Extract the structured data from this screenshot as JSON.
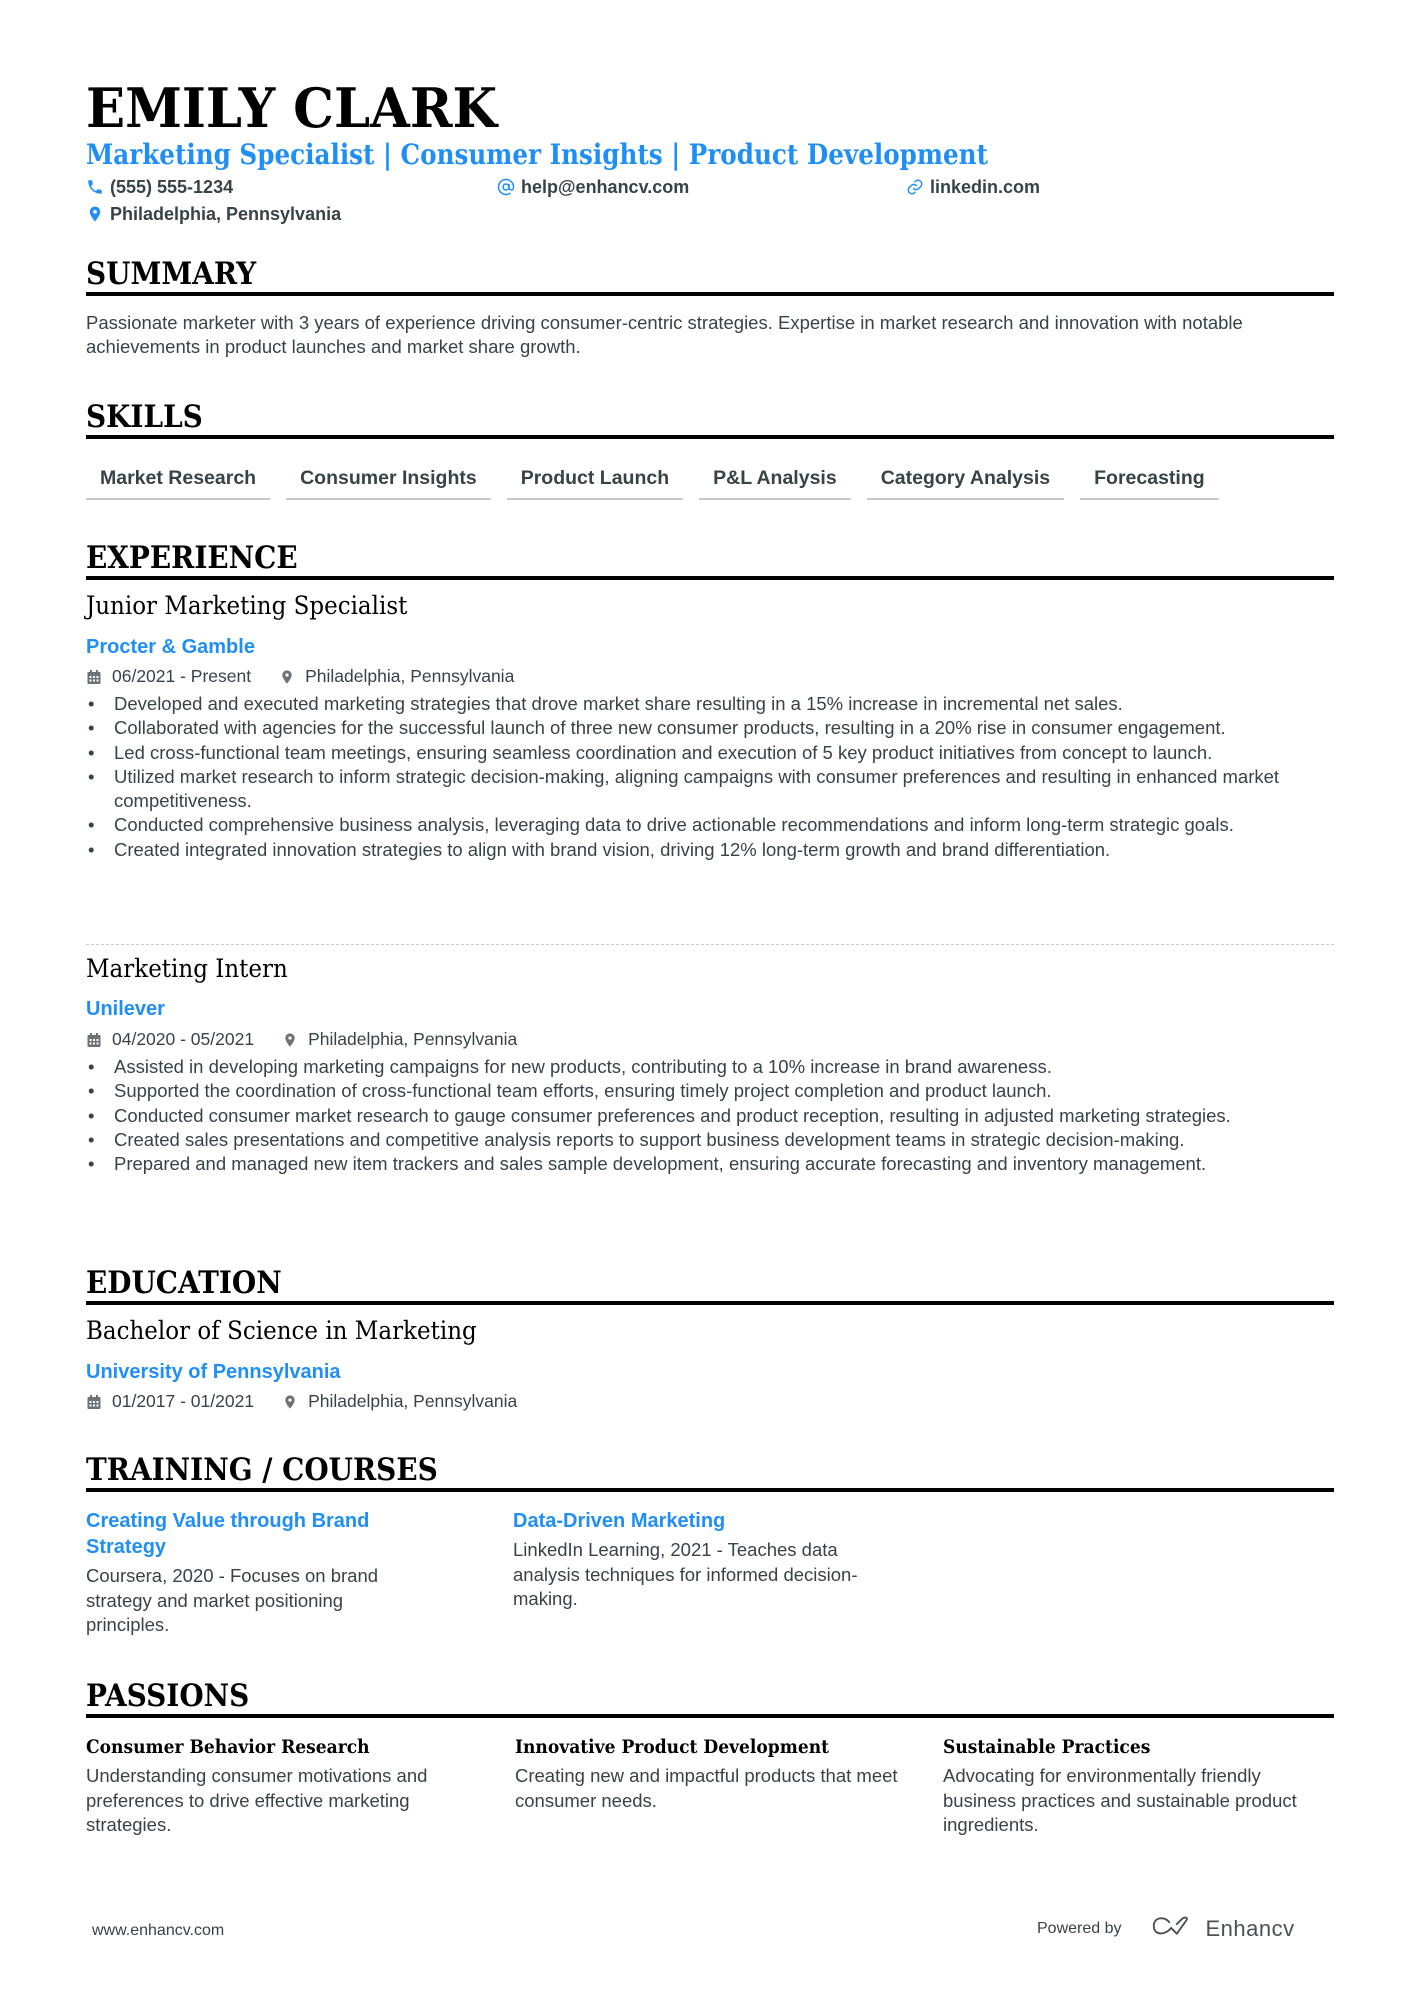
{
  "header": {
    "name": "EMILY CLARK",
    "subtitle": "Marketing Specialist | Consumer Insights | Product Development",
    "contacts": {
      "phone": {
        "icon": "phone-icon",
        "value": "(555) 555-1234"
      },
      "email": {
        "icon": "at-icon",
        "value": "help@enhancv.com"
      },
      "linkedin": {
        "icon": "link-icon",
        "value": "linkedin.com"
      },
      "location": {
        "icon": "location-pin-icon",
        "value": "Philadelphia, Pennsylvania"
      }
    }
  },
  "summary": {
    "heading": "SUMMARY",
    "text": "Passionate marketer with 3 years of experience driving consumer-centric strategies. Expertise in market research and innovation with notable achievements in product launches and market share growth."
  },
  "skills": {
    "heading": "SKILLS",
    "items": [
      "Market Research",
      "Consumer Insights",
      "Product Launch",
      "P&L Analysis",
      "Category Analysis",
      "Forecasting"
    ]
  },
  "experience": {
    "heading": "EXPERIENCE",
    "jobs": [
      {
        "title": "Junior Marketing Specialist",
        "company": "Procter & Gamble",
        "dates": "06/2021 - Present",
        "location": "Philadelphia, Pennsylvania",
        "bullets": [
          "Developed and executed marketing strategies that drove market share resulting in a 15% increase in incremental net sales.",
          "Collaborated with agencies for the successful launch of three new consumer products, resulting in a 20% rise in consumer engagement.",
          "Led cross-functional team meetings, ensuring seamless coordination and execution of 5 key product initiatives from concept to launch.",
          "Utilized market research to inform strategic decision-making, aligning campaigns with consumer preferences and resulting in enhanced market competitiveness.",
          "Conducted comprehensive business analysis, leveraging data to drive actionable recommendations and inform long-term strategic goals.",
          "Created integrated innovation strategies to align with brand vision, driving 12% long-term growth and brand differentiation."
        ]
      },
      {
        "title": "Marketing Intern",
        "company": "Unilever",
        "dates": "04/2020 - 05/2021",
        "location": "Philadelphia, Pennsylvania",
        "bullets": [
          "Assisted in developing marketing campaigns for new products, contributing to a 10% increase in brand awareness.",
          "Supported the coordination of cross-functional team efforts, ensuring timely project completion and product launch.",
          "Conducted consumer market research to gauge consumer preferences and product reception, resulting in adjusted marketing strategies.",
          "Created sales presentations and competitive analysis reports to support business development teams in strategic decision-making.",
          "Prepared and managed new item trackers and sales sample development, ensuring accurate forecasting and inventory management."
        ]
      }
    ]
  },
  "education": {
    "heading": "EDUCATION",
    "degree": "Bachelor of Science in Marketing",
    "school": "University of Pennsylvania",
    "dates": "01/2017 - 01/2021",
    "location": "Philadelphia, Pennsylvania"
  },
  "training": {
    "heading": "TRAINING / COURSES",
    "items": [
      {
        "title": "Creating Value through Brand Strategy",
        "description": "Coursera, 2020 - Focuses on brand strategy and market positioning principles."
      },
      {
        "title": "Data-Driven Marketing",
        "description": "LinkedIn Learning, 2021 - Teaches data analysis techniques for informed decision-making."
      }
    ]
  },
  "passions": {
    "heading": "PASSIONS",
    "items": [
      {
        "title": "Consumer Behavior Research",
        "description": "Understanding consumer motivations and preferences to drive effective marketing strategies."
      },
      {
        "title": "Innovative Product Development",
        "description": "Creating new and impactful products that meet consumer needs."
      },
      {
        "title": "Sustainable Practices",
        "description": "Advocating for environmentally friendly business practices and sustainable product ingredients."
      }
    ]
  },
  "footer": {
    "website": "www.enhancv.com",
    "powered_by": "Powered by",
    "brand": "Enhancv"
  },
  "colors": {
    "accent": "#1f8ff5",
    "text": "#384347",
    "heading": "#000000"
  }
}
